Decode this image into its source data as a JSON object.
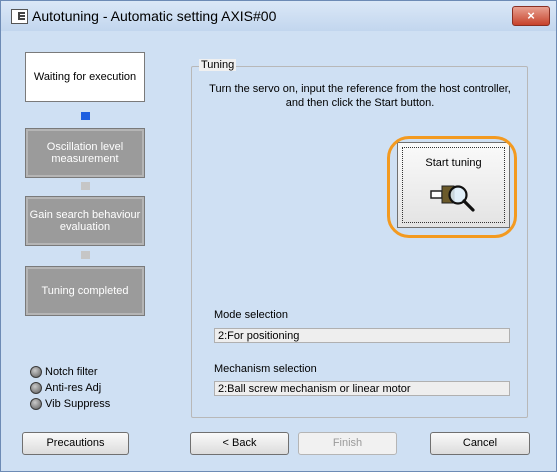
{
  "window": {
    "title": "Autotuning - Automatic setting AXIS#00",
    "close_label": "×"
  },
  "steps": [
    {
      "label": "Waiting for execution",
      "state": "active"
    },
    {
      "label": "Oscillation level measurement",
      "state": "inactive"
    },
    {
      "label": "Gain search behaviour evaluation",
      "state": "inactive"
    },
    {
      "label": "Tuning completed",
      "state": "inactive"
    }
  ],
  "tuning": {
    "group_label": "Tuning",
    "instructions": "Turn the servo on, input the reference from the host controller, and then click the Start button.",
    "start_button_label": "Start tuning",
    "mode_selection_label": "Mode selection",
    "mode_selection_value": "2:For positioning",
    "mechanism_selection_label": "Mechanism selection",
    "mechanism_selection_value": "2:Ball screw mechanism or linear motor"
  },
  "indicators": [
    {
      "label": "Notch filter"
    },
    {
      "label": "Anti-res Adj"
    },
    {
      "label": "Vib Suppress"
    }
  ],
  "buttons": {
    "precautions": "Precautions",
    "back": "< Back",
    "finish": "Finish",
    "cancel": "Cancel"
  },
  "colors": {
    "active_connector": "#1e5fe0",
    "highlight": "#f39a20",
    "close_button": "#c7422b"
  }
}
